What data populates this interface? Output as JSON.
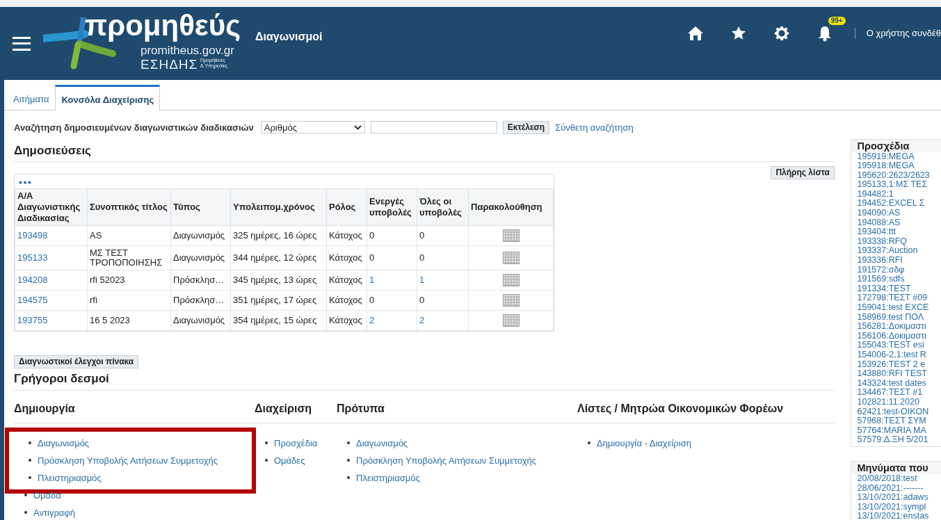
{
  "header": {
    "logo": {
      "name": "προμηθεύς",
      "site": "promitheus.gov.gr",
      "system": "ΕΣΗΔΗΣ",
      "tagline_1": "Προμήθειες",
      "tagline_2": "& Υπηρεσίες"
    },
    "title": "Διαγωνισμοί",
    "notifications_badge": "99+",
    "user_text": "Ο χρήστης συνδέθ"
  },
  "tabs": [
    {
      "label": "Αιτήματα",
      "selected": false
    },
    {
      "label": "Κονσόλα Διαχείρισης",
      "selected": true
    }
  ],
  "search": {
    "label": "Αναζήτηση δημοσιευμένων διαγωνιστικών διαδικασιών",
    "select_value": "Αριθμός",
    "button": "Εκτέλεση",
    "advanced_link": "Σύνθετη αναζήτηση"
  },
  "publications": {
    "title": "Δημοσιεύσεις",
    "full_list_button": "Πλήρης λίστα",
    "table": {
      "columns": [
        "Α/Α Διαγωνιστικής Διαδικασίας",
        "Συνοπτικός τίτλος",
        "Τύπος",
        "Υπολειπομ.χρόνος",
        "Ρόλος",
        "Ενεργές υποβολές",
        "Όλες οι υποβολές",
        "Παρακολούθηση"
      ],
      "rows": [
        {
          "id": "193498",
          "title": "AS",
          "type": "Διαγωνισμός",
          "remaining": "325 ημέρες, 16 ώρες",
          "role": "Κάτοχος",
          "active": "0",
          "all": "0",
          "counts_linked": false
        },
        {
          "id": "195133",
          "title": "ΜΣ ΤΕΣΤ ΤΡΟΠΟΠΟΙΗΣΗΣ",
          "type": "Διαγωνισμός",
          "remaining": "344 ημέρες, 12 ώρες",
          "role": "Κάτοχος",
          "active": "0",
          "all": "0",
          "counts_linked": false
        },
        {
          "id": "194208",
          "title": "rfi 52023",
          "type": "Πρόσκλησ…",
          "remaining": "345 ημέρες, 13 ώρες",
          "role": "Κάτοχος",
          "active": "1",
          "all": "1",
          "counts_linked": true
        },
        {
          "id": "194575",
          "title": "rfi",
          "type": "Πρόσκλησ…",
          "remaining": "351 ημέρες, 17 ώρες",
          "role": "Κάτοχος",
          "active": "0",
          "all": "0",
          "counts_linked": false
        },
        {
          "id": "193755",
          "title": "16 5 2023",
          "type": "Διαγωνισμός",
          "remaining": "354 ημέρες, 15 ώρες",
          "role": "Κάτοχος",
          "active": "2",
          "all": "2",
          "counts_linked": true
        }
      ]
    },
    "diagnostics_button": "Διαγνωστικοί έλεγχοι πίνακα"
  },
  "quick_links": {
    "title": "Γρήγοροι δεσμοί",
    "groups": [
      {
        "title": "Δημιουργία",
        "links": [
          {
            "label": "Διαγωνισμός",
            "highlighted": true
          },
          {
            "label": "Πρόσκληση Υποβολής Αιτήσεων Συμμετοχής",
            "highlighted": true
          },
          {
            "label": "Πλειστηριασμός",
            "highlighted": true
          },
          {
            "label": "Ομάδα",
            "highlighted": false
          },
          {
            "label": "Αντιγραφή",
            "highlighted": false
          }
        ]
      },
      {
        "title": "Διαχείριση",
        "links": [
          {
            "label": "Προσχέδια",
            "highlighted": false
          },
          {
            "label": "Ομάδες",
            "highlighted": false
          }
        ]
      },
      {
        "title": "Πρότυπα",
        "links": [
          {
            "label": "Διαγωνισμός",
            "highlighted": false
          },
          {
            "label": "Πρόσκληση Υποβολής Αιτήσεων Συμμετοχής",
            "highlighted": false
          },
          {
            "label": "Πλειστηριασμός",
            "highlighted": false
          }
        ]
      },
      {
        "title": "Λίστες / Μητρώα Οικονομικών Φορέων",
        "links": [
          {
            "label": "Δημιουργία - Διαχείριση",
            "highlighted": false
          }
        ]
      }
    ]
  },
  "drafts": {
    "title": "Προσχέδια",
    "items": [
      "195919:MEGA",
      "195918:MEGA",
      "195620:2623/2623",
      "195133,1:ΜΣ ΤΕΣ",
      "194482:1",
      "194452:EXCEL Σ",
      "194090:AS",
      "194088:AS",
      "193404:ttt",
      "193338:RFQ",
      "193337:Auction",
      "193336:RFI",
      "191572:σδφ",
      "191569:sdfs",
      "191334:TEST",
      "172798:ΤΕΣΤ #09",
      "159041:test EXCE",
      "158969:test ΠΟΛ",
      "156281:Δοκιμαστι",
      "156106:Δοκιμαστι",
      "155043:TEST esi",
      "154006-2,1:test R",
      "153926:TEST 2 e",
      "143880:RFI TEST",
      "143324:test dates",
      "134467:ΤΕΣΤ #1",
      "102821:11.2020",
      "62421:test-OIKON",
      "57968:ΤΕΣΤ ΣΥΜ",
      "57764:MARIA MA",
      "57579:Δ.ΞΗ 5/201"
    ]
  },
  "messages": {
    "title": "Μηνύματα που",
    "items": [
      "20/08/2018:test",
      "28/06/2021:-------",
      "13/10/2021:adaws",
      "13/10/2021:sympl",
      "13/10/2021:enstas"
    ]
  }
}
